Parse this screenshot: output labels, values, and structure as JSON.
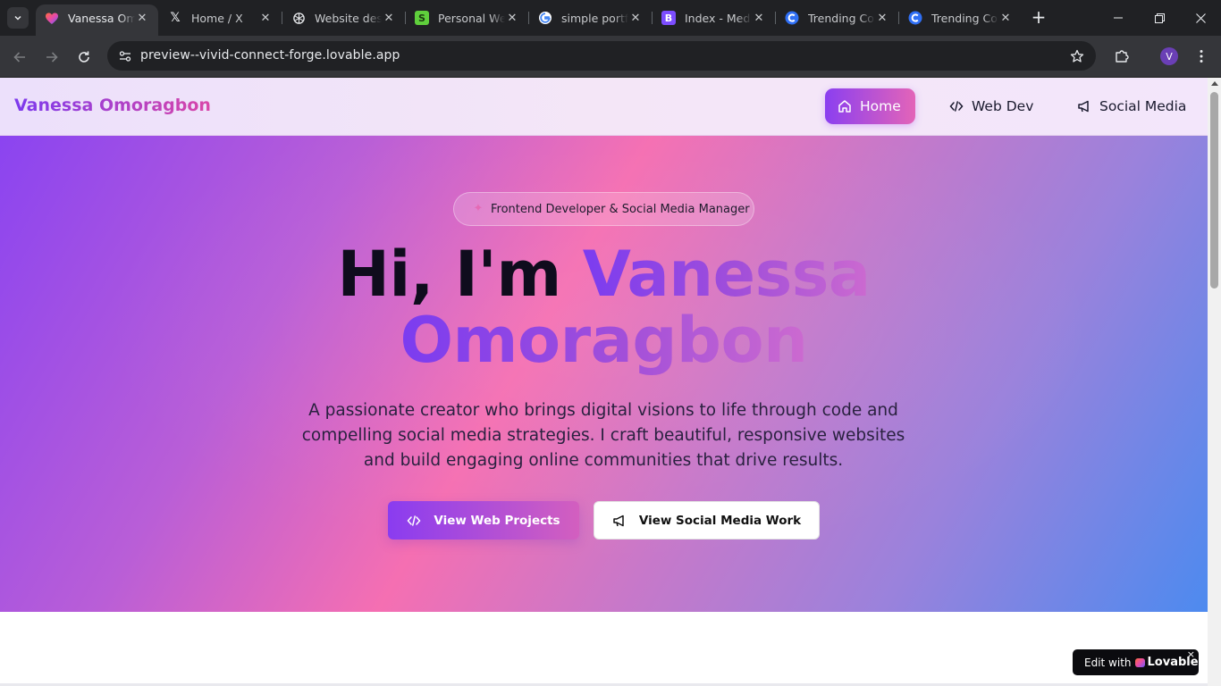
{
  "browser": {
    "tabs": [
      {
        "title": "Vanessa Omoragbon",
        "favicon": "lovable-heart-icon",
        "active": true
      },
      {
        "title": "Home / X",
        "favicon": "x-logo-icon",
        "active": false
      },
      {
        "title": "Website design",
        "favicon": "openai-icon",
        "active": false
      },
      {
        "title": "Personal Website",
        "favicon": "green-s-icon",
        "active": false
      },
      {
        "title": "simple portfolio",
        "favicon": "google-icon",
        "active": false
      },
      {
        "title": "Index - Media",
        "favicon": "purple-b-icon",
        "active": false
      },
      {
        "title": "Trending Colors",
        "favicon": "coolors-icon",
        "active": false
      },
      {
        "title": "Trending Colors",
        "favicon": "coolors-icon",
        "active": false
      }
    ],
    "url": "preview--vivid-connect-forge.lovable.app",
    "profile_initial": "V"
  },
  "site": {
    "brand": "Vanessa Omoragbon",
    "nav": [
      {
        "label": "Home",
        "icon": "home-icon",
        "active": true
      },
      {
        "label": "Web Dev",
        "icon": "code-icon",
        "active": false
      },
      {
        "label": "Social Media",
        "icon": "megaphone-icon",
        "active": false
      }
    ]
  },
  "hero": {
    "badge": "Frontend Developer & Social Media Manager",
    "greeting": "Hi, I'm",
    "name_line1": "Vanessa",
    "name_line2": "Omoragbon",
    "description": "A passionate creator who brings digital visions to life through code and compelling social media strategies. I craft beautiful, responsive websites and build engaging online communities that drive results.",
    "primary_button": "View Web Projects",
    "secondary_button": "View Social Media Work"
  },
  "lovable_badge": {
    "prefix": "Edit with",
    "brand": "Lovable",
    "close": "×"
  },
  "colors": {
    "accent_purple": "#8b3ff0",
    "accent_pink": "#f56fb2",
    "accent_blue": "#4d8aef"
  }
}
